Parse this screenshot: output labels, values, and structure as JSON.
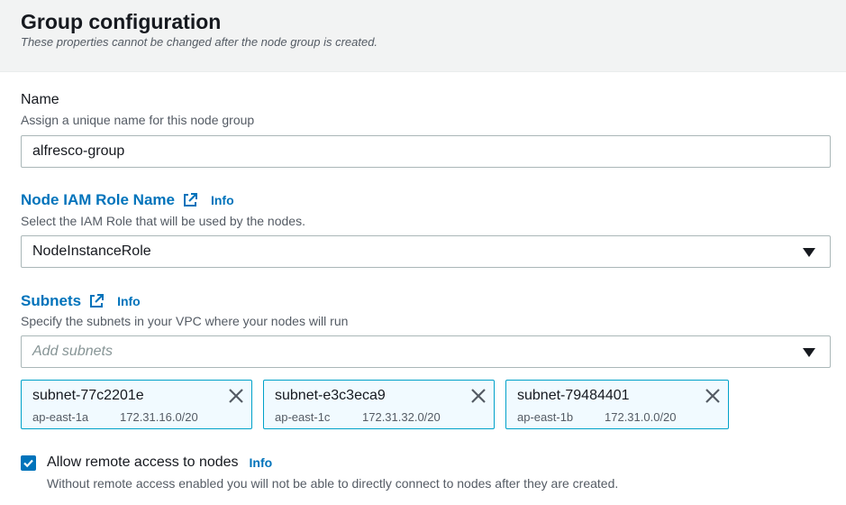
{
  "header": {
    "title": "Group configuration",
    "subtitle": "These properties cannot be changed after the node group is created."
  },
  "name_field": {
    "label": "Name",
    "description": "Assign a unique name for this node group",
    "value": "alfresco-group"
  },
  "iam_role": {
    "label": "Node IAM Role Name",
    "info": "Info",
    "description": "Select the IAM Role that will be used by the nodes.",
    "selected": "NodeInstanceRole"
  },
  "subnets": {
    "label": "Subnets",
    "info": "Info",
    "description": "Specify the subnets in your VPC where your nodes will run",
    "placeholder": "Add subnets",
    "items": [
      {
        "id": "subnet-77c2201e",
        "az": "ap-east-1a",
        "cidr": "172.31.16.0/20"
      },
      {
        "id": "subnet-e3c3eca9",
        "az": "ap-east-1c",
        "cidr": "172.31.32.0/20"
      },
      {
        "id": "subnet-79484401",
        "az": "ap-east-1b",
        "cidr": "172.31.0.0/20"
      }
    ]
  },
  "remote_access": {
    "label": "Allow remote access to nodes",
    "info": "Info",
    "checked": true,
    "description": "Without remote access enabled you will not be able to directly connect to nodes after they are created."
  },
  "colors": {
    "link": "#0073bb",
    "token_border": "#00a1c9",
    "token_bg": "#f1faff",
    "header_bg": "#f2f3f3"
  }
}
